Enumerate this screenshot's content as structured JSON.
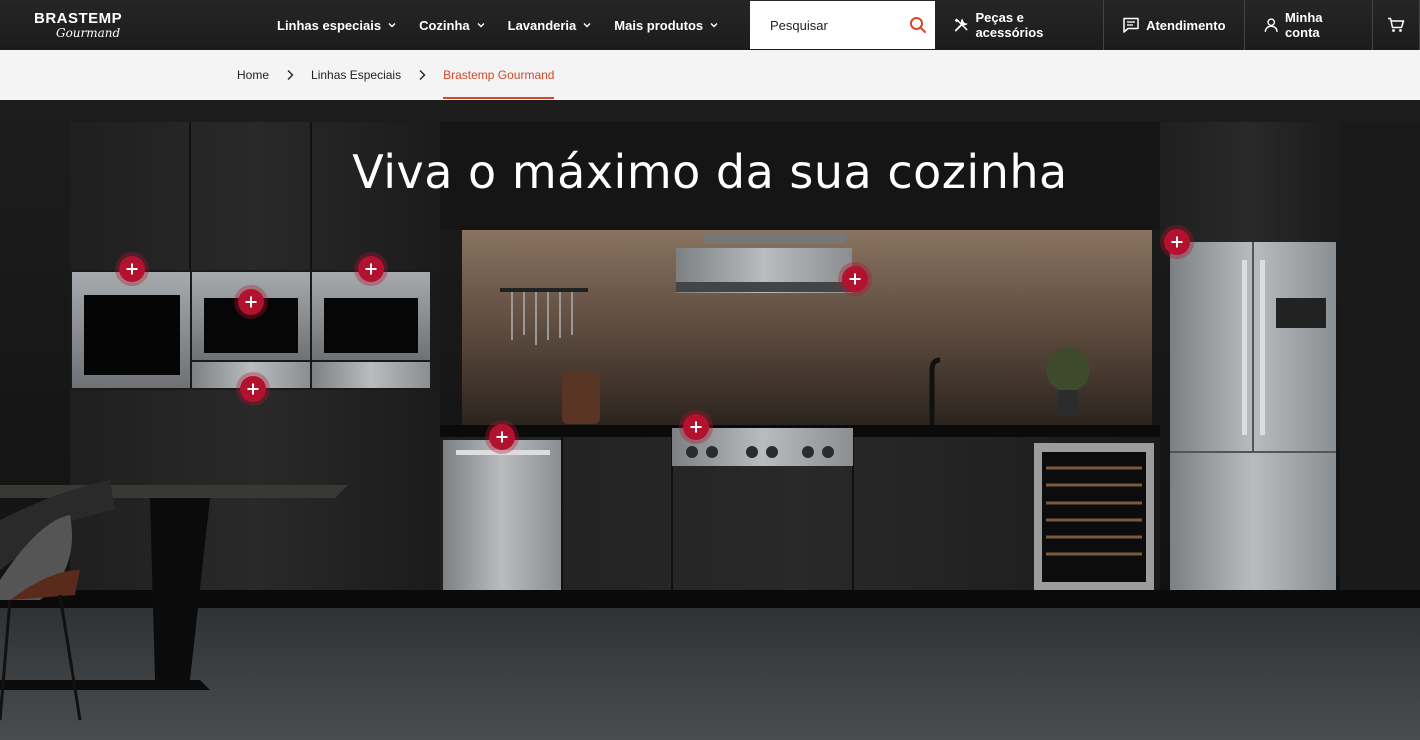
{
  "header": {
    "logo": {
      "brand": "BRASTEMP",
      "sub": "Gourmand"
    },
    "nav": [
      {
        "label": "Linhas especiais"
      },
      {
        "label": "Cozinha"
      },
      {
        "label": "Lavanderia"
      },
      {
        "label": "Mais produtos"
      }
    ],
    "search": {
      "placeholder": "Pesquisar"
    },
    "utility": [
      {
        "label": "Peças e acessórios",
        "icon": "tools-icon"
      },
      {
        "label": "Atendimento",
        "icon": "chat-icon"
      },
      {
        "label": "Minha conta",
        "icon": "user-icon"
      },
      {
        "label": "",
        "icon": "cart-icon"
      }
    ]
  },
  "breadcrumb": [
    {
      "label": "Home"
    },
    {
      "label": "Linhas Especiais"
    },
    {
      "label": "Brastemp Gourmand",
      "active": true
    }
  ],
  "hero": {
    "headline": "Viva o máximo da sua cozinha",
    "hotspots": [
      {
        "name": "hotspot-oven-left"
      },
      {
        "name": "hotspot-oven-middle"
      },
      {
        "name": "hotspot-oven-right"
      },
      {
        "name": "hotspot-drawer-top"
      },
      {
        "name": "hotspot-drawer-bottom"
      },
      {
        "name": "hotspot-range-hood"
      },
      {
        "name": "hotspot-refrigerator"
      },
      {
        "name": "hotspot-dishwasher"
      },
      {
        "name": "hotspot-cooktop"
      }
    ]
  },
  "colors": {
    "accent": "#d5472a",
    "hotspot": "#b3122f",
    "header": "#222222"
  }
}
